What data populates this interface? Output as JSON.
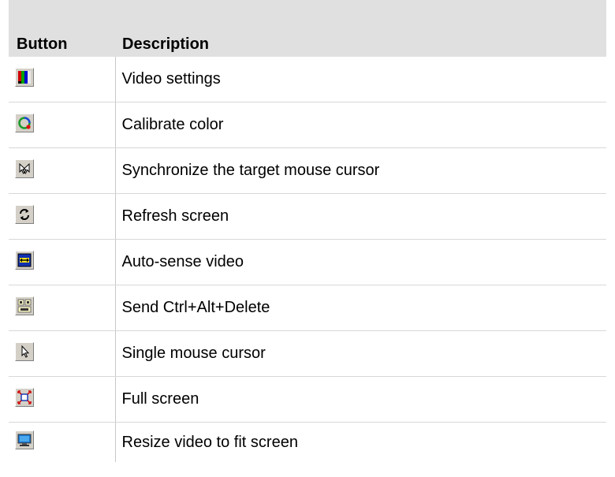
{
  "table": {
    "headers": {
      "button": "Button",
      "description": "Description"
    },
    "rows": [
      {
        "icon": "video-settings-icon",
        "description": "Video settings"
      },
      {
        "icon": "calibrate-color-icon",
        "description": "Calibrate color"
      },
      {
        "icon": "synchronize-mouse-icon",
        "description": "Synchronize the target mouse cursor"
      },
      {
        "icon": "refresh-icon",
        "description": "Refresh screen"
      },
      {
        "icon": "auto-sense-video-icon",
        "description": "Auto-sense video"
      },
      {
        "icon": "ctrl-alt-delete-icon",
        "description": "Send Ctrl+Alt+Delete"
      },
      {
        "icon": "single-cursor-icon",
        "description": "Single mouse cursor"
      },
      {
        "icon": "full-screen-icon",
        "description": "Full screen"
      },
      {
        "icon": "resize-video-icon",
        "description": "Resize video to fit screen"
      }
    ]
  },
  "colors": {
    "header_bg": "#e0e0e0",
    "button_face": "#d4d0c8"
  }
}
